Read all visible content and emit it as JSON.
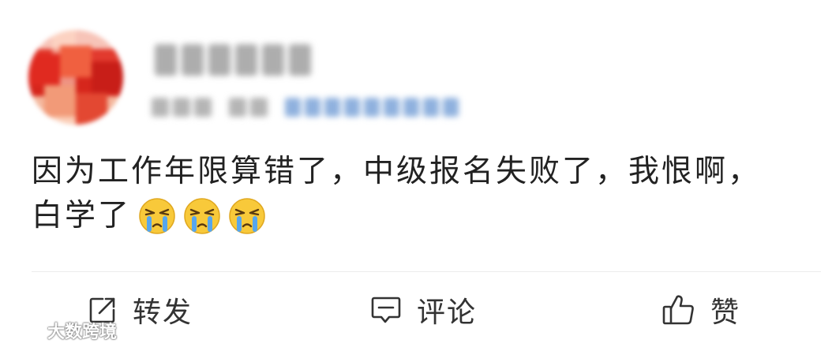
{
  "post": {
    "text_line1": "因为工作年限算错了，中级报名失败了，我恨啊，",
    "text_line2": "白学了",
    "emojis": [
      "crying-emoji",
      "crying-emoji",
      "crying-emoji"
    ]
  },
  "actions": {
    "share_label": "转发",
    "comment_label": "评论",
    "like_label": "赞"
  },
  "watermark": {
    "text": "大数跨境"
  },
  "colors": {
    "emoji_face": "#f8c93a",
    "tears": "#56a6ee",
    "icon_stroke": "#333333"
  }
}
